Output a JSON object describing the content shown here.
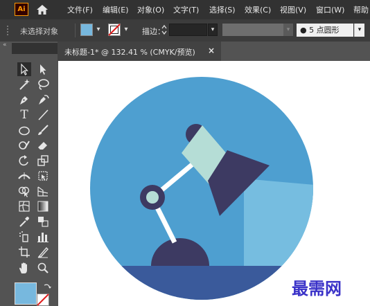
{
  "app": {
    "logo_text": "Ai"
  },
  "menu": [
    {
      "label": "文件(F)"
    },
    {
      "label": "编辑(E)"
    },
    {
      "label": "对象(O)"
    },
    {
      "label": "文字(T)"
    },
    {
      "label": "选择(S)"
    },
    {
      "label": "效果(C)"
    },
    {
      "label": "视图(V)"
    },
    {
      "label": "窗口(W)"
    },
    {
      "label": "帮助"
    }
  ],
  "control_bar": {
    "selection_status": "未选择对象",
    "fill_color": "#77b8de",
    "stroke_label": "描边：",
    "stroke_value": "",
    "brush_value": "●  5 点圆形"
  },
  "document": {
    "tab_title": "未标题-1* @ 132.41 % (CMYK/预览)",
    "close_glyph": "×"
  },
  "toolbar": {
    "fill_swatch": "#77b8de",
    "collapse_glyph": "«"
  },
  "colors": {
    "circle_bg": "#4e9fd0",
    "ground": "#3a5a9b",
    "lamp_dark": "#3d3a62",
    "lamp_shade_light": "#b5ddd6",
    "light_beam": "#76bde0",
    "arm": "#ffffff",
    "joint_inner": "#b5ddd6"
  },
  "watermark": {
    "text": "最需网"
  }
}
